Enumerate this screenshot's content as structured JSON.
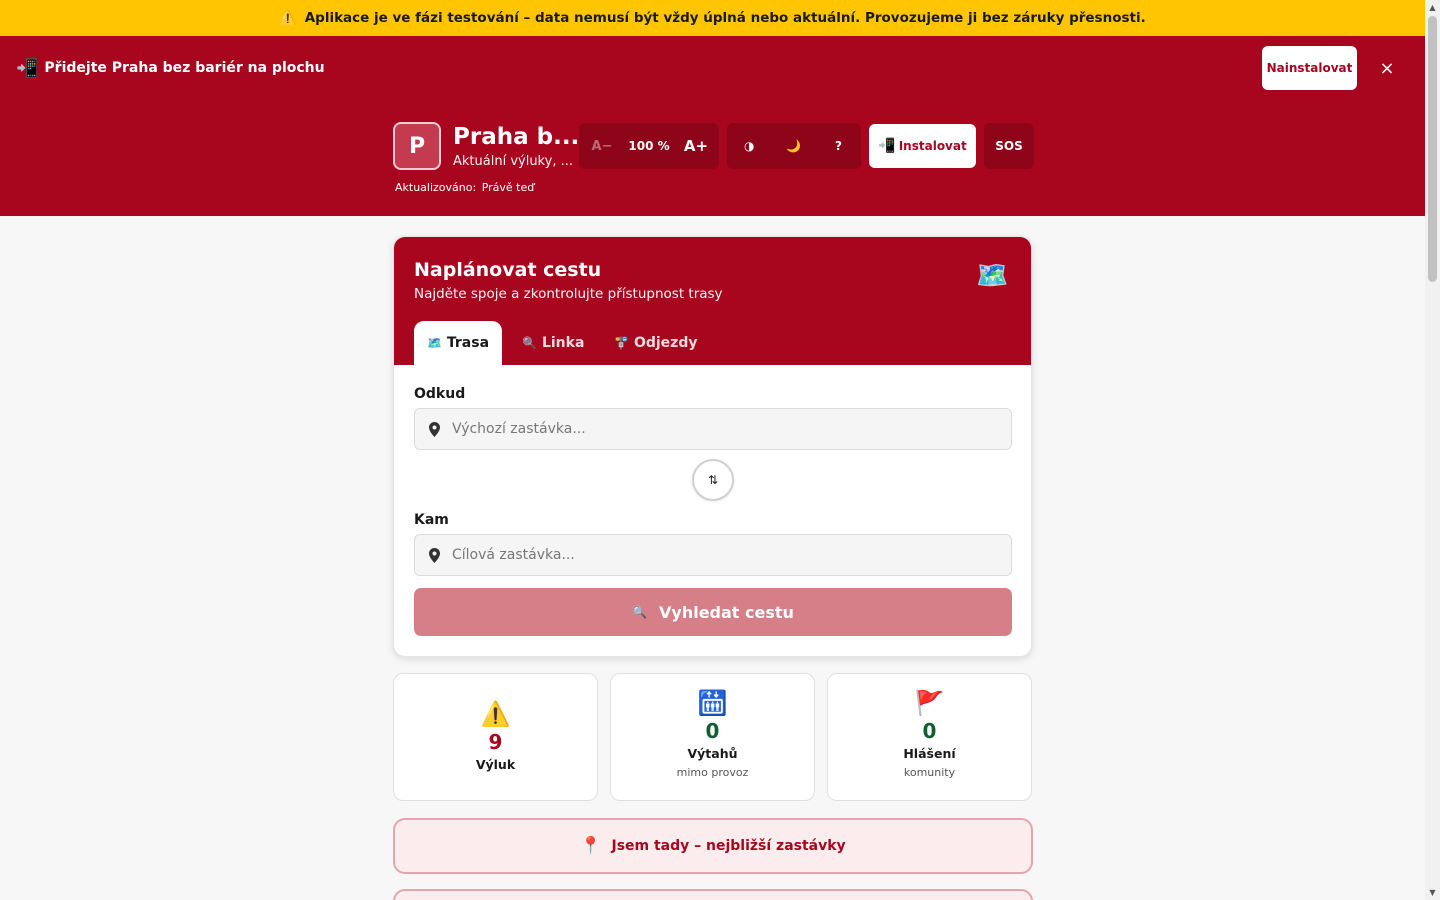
{
  "banner": {
    "icon": "warning-icon",
    "text": "Aplikace je ve fázi testování – data nemusí být vždy úplná nebo aktuální. Provozujeme ji bez záruky přesnosti."
  },
  "install_prompt": {
    "text": "Přidejte Praha bez bariér na plochu",
    "button": "Nainstalovat",
    "close": "×"
  },
  "header": {
    "logo_letter": "P",
    "title": "Praha b...",
    "subtitle": "Aktuální výluky, ...",
    "updated_label": "Aktualizováno:",
    "updated_value": "Právě teď",
    "font_decrease": "A−",
    "zoom": "100 %",
    "font_increase": "A+",
    "contrast_icon": "◑",
    "dark_mode_icon": "🌙",
    "help": "?",
    "install": "Instalovat",
    "sos": "SOS"
  },
  "planner": {
    "title": "Naplánovat cestu",
    "subtitle": "Najděte spoje a zkontrolujte přístupnost trasy",
    "tabs": [
      {
        "label": "Trasa",
        "icon": "🗺️",
        "active": true
      },
      {
        "label": "Linka",
        "icon": "🔍",
        "active": false
      },
      {
        "label": "Odjezdy",
        "icon": "🚏",
        "active": false
      }
    ],
    "from_label": "Odkud",
    "from_placeholder": "Výchozí zastávka...",
    "to_label": "Kam",
    "to_placeholder": "Cílová zastávka...",
    "search_button": "Vyhledat cestu"
  },
  "stats": [
    {
      "icon": "⚠️",
      "value": "9",
      "label": "Výluk",
      "sub": ""
    },
    {
      "icon": "🛗",
      "value": "0",
      "label": "Výtahů",
      "sub": "mimo provoz"
    },
    {
      "icon": "🚩",
      "value": "0",
      "label": "Hlášení",
      "sub": "komunity"
    }
  ],
  "nearby_button": "Jsem tady – nejbližší zastávky",
  "colors": {
    "brand": "#a8061f",
    "banner": "#ffc600",
    "search_disabled": "#d67f89",
    "positive": "#0f5e2f"
  }
}
